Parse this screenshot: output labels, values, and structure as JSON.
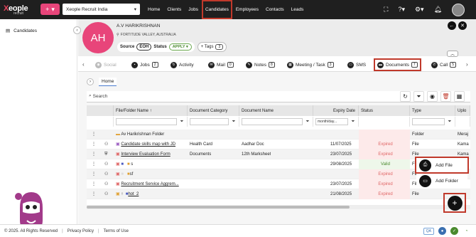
{
  "topbar": {
    "logo_text": "eople",
    "logo_prefix": "X",
    "logo_sub": "recruit",
    "add_label": "+",
    "org_select": "Xeople Recruit India",
    "nav": [
      "Home",
      "Clients",
      "Jobs",
      "Candidates",
      "Employees",
      "Contacts",
      "Leads"
    ],
    "active_nav": "Candidates"
  },
  "sidebar": {
    "items": [
      {
        "label": "Candidates"
      }
    ]
  },
  "candidate": {
    "initials": "AH",
    "name": "A.V HARIKRISHNAN",
    "location": "FORTITUDE VALLEY, AUSTRALIA",
    "source_label": "Source",
    "source_value": "EOH",
    "status_label": "Status",
    "status_value": "APPLY",
    "tags_label": "+ Tags",
    "tags_count": "3"
  },
  "tabs": [
    {
      "label": "Social",
      "badge": "",
      "muted": true
    },
    {
      "label": "Jobs",
      "badge": "2"
    },
    {
      "label": "Activity",
      "badge": ""
    },
    {
      "label": "Mail",
      "badge": "0"
    },
    {
      "label": "Notes",
      "badge": "8"
    },
    {
      "label": "Meeting / Task",
      "badge": "3"
    },
    {
      "label": "SMS",
      "badge": ""
    },
    {
      "label": "Documents",
      "badge": "7",
      "active": true
    },
    {
      "label": "Call",
      "badge": "5"
    }
  ],
  "breadcrumb": {
    "home": "Home"
  },
  "toolbar": {
    "search_placeholder": "Search"
  },
  "table": {
    "headers": [
      "File/Folder Name",
      "Document Category",
      "Document Name",
      "Expiry Date",
      "Status",
      "Type",
      "Uplo"
    ],
    "date_filter": "month/day...",
    "rows": [
      {
        "name": "Av Harikrishnan Folder",
        "category": "",
        "doc": "",
        "expiry": "",
        "status": "",
        "type": "Folder",
        "upload": "Meraj"
      },
      {
        "name": "Candidate skills map with JD",
        "category": "Health Card",
        "doc": "Aadhar Doc",
        "expiry": "11/07/2025",
        "status": "Expired",
        "type": "File",
        "upload": "Kama"
      },
      {
        "name": "Interview Evaluation Form",
        "category": "Documents",
        "doc": "12th Marksheet",
        "expiry": "23/07/2025",
        "status": "Expired",
        "type": "File",
        "upload": "Kama"
      },
      {
        "name": "s",
        "category": "",
        "doc": "",
        "expiry": "29/08/2025",
        "status": "Valid",
        "type": "File",
        "upload": ""
      },
      {
        "name": "sf",
        "category": "",
        "doc": "",
        "expiry": "",
        "status": "Expired",
        "type": "File",
        "upload": ""
      },
      {
        "name": "Recruitment Service Aggrem...",
        "category": "",
        "doc": "",
        "expiry": "23/07/2025",
        "status": "Expired",
        "type": "File",
        "upload": ""
      },
      {
        "name": "hot_2",
        "category": "",
        "doc": "",
        "expiry": "21/08/2025",
        "status": "Expired",
        "type": "File",
        "upload": ""
      }
    ]
  },
  "popup": {
    "add_file": "Add File",
    "add_folder": "Add Folder"
  },
  "fab_label": "+",
  "footer": {
    "copyright": "© 2025. All Rights Reserved",
    "privacy": "Privacy Policy",
    "terms": "Terms of Use",
    "qa": "QA"
  },
  "colors": {
    "brand": "#e8457a",
    "highlight": "#c0392b",
    "topbar": "#1f1f1f"
  }
}
